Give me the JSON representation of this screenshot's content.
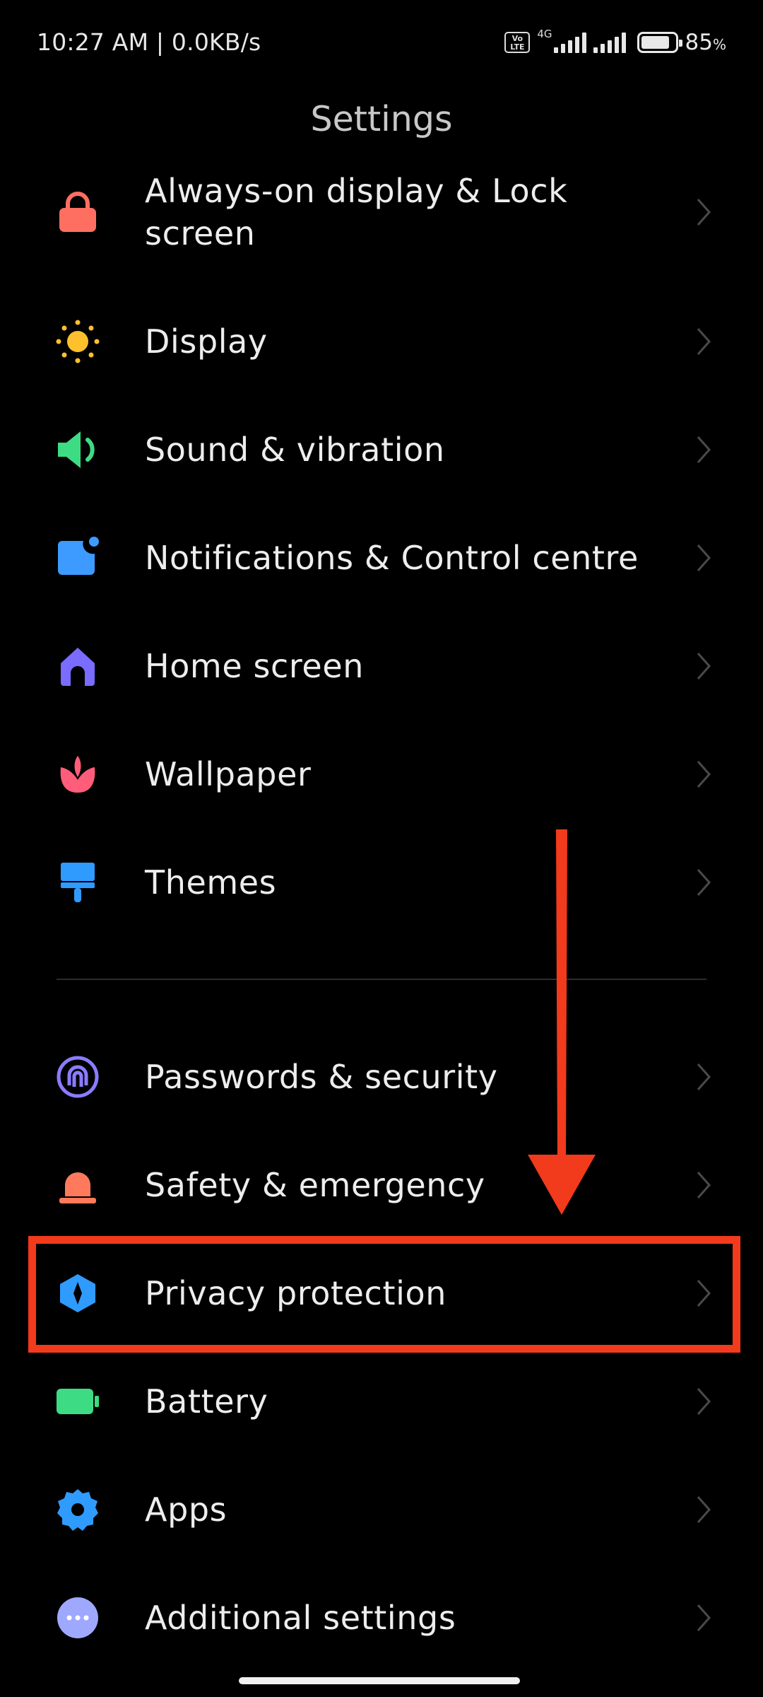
{
  "status_bar": {
    "time_speed": "10:27 AM | 0.0KB/s",
    "volte": "Vo LTE",
    "network_type": "4G",
    "battery_level": 0.85,
    "battery_percent": "85",
    "battery_unit": "%"
  },
  "header": {
    "title": "Settings"
  },
  "settings": {
    "items": [
      {
        "label": "Always-on display & Lock screen",
        "icon": "lock-icon",
        "color": "#ff6f61"
      },
      {
        "label": "Display",
        "icon": "sun-icon",
        "color": "#ffc02e"
      },
      {
        "label": "Sound & vibration",
        "icon": "speaker-icon",
        "color": "#3ddc84"
      },
      {
        "label": "Notifications & Control centre",
        "icon": "notification-icon",
        "color": "#3d9bff"
      },
      {
        "label": "Home screen",
        "icon": "home-icon",
        "color": "#7a6cff"
      },
      {
        "label": "Wallpaper",
        "icon": "flower-icon",
        "color": "#ff5d7a"
      },
      {
        "label": "Themes",
        "icon": "brush-icon",
        "color": "#2f9bff"
      },
      {
        "label": "Passwords & security",
        "icon": "fingerprint-icon",
        "color": "#8a7cff"
      },
      {
        "label": "Safety & emergency",
        "icon": "siren-icon",
        "color": "#ff7a5c"
      },
      {
        "label": "Privacy protection",
        "icon": "privacy-shield-icon",
        "color": "#2f9bff"
      },
      {
        "label": "Battery",
        "icon": "battery-icon",
        "color": "#3ddc84"
      },
      {
        "label": "Apps",
        "icon": "gear-icon",
        "color": "#2f9bff"
      },
      {
        "label": "Additional settings",
        "icon": "more-dots-icon",
        "color": "#9fa8ff"
      }
    ]
  },
  "annotation": {
    "highlight_color": "#f23a1c"
  }
}
